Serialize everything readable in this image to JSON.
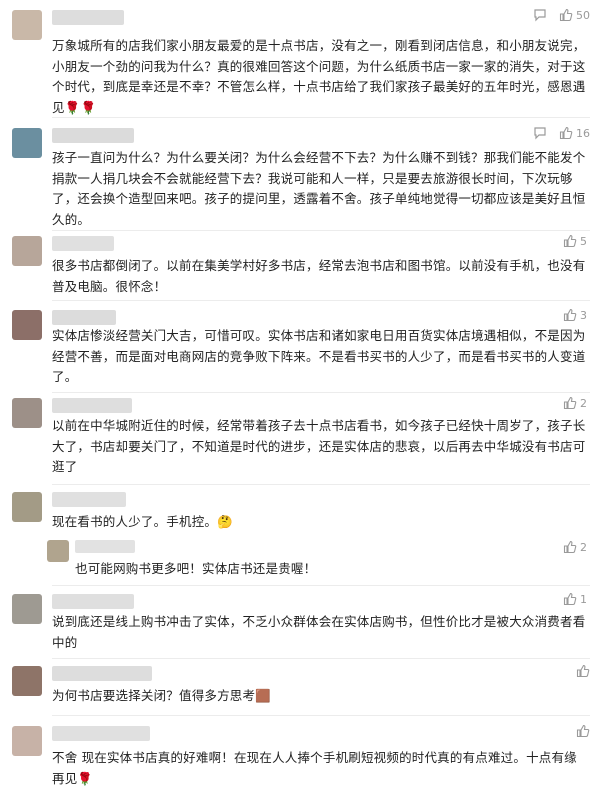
{
  "comments": [
    {
      "text": "万象城所有的店我们家小朋友最爱的是十点书店，没有之一，刚看到闭店信息，和小朋友说完，小朋友一个劲的问我为什么？真的很难回答这个问题，为什么纸质书店一家一家的消失，对于这个时代，到底是幸还是不幸？不管怎么样，十点书店给了我们家孩子最美好的五年时光，感恩遇见🌹🌹",
      "likes": "50",
      "avatar_color": "#c9b8a8",
      "name_color": "#d2d2d2"
    },
    {
      "text": "孩子一直问为什么？为什么要关闭？为什么会经营不下去？为什么赚不到钱？那我们能不能发个捐款一人捐几块会不会就能经营下去？我说可能和人一样，只是要去旅游很长时间，下次玩够了，还会换个造型回来吧。孩子的提问里，透露着不舍。孩子单纯地觉得一切都应该是美好且恒久的。",
      "likes": "16",
      "avatar_color": "#6b8fa0",
      "name_color": "#cfcfcf"
    },
    {
      "text": "很多书店都倒闭了。以前在集美学村好多书店，经常去泡书店和图书馆。以前没有手机，也没有普及电脑。很怀念！",
      "likes": "5",
      "avatar_color": "#b7a69a",
      "name_color": "#d5d5d5"
    },
    {
      "text": "实体店惨淡经营关门大吉，可惜可叹。实体书店和诸如家电日用百货实体店境遇相似，不是因为经营不善，而是面对电商网店的竞争败下阵来。不是看书买书的人少了，而是看书买书的人变道了。",
      "likes": "3",
      "avatar_color": "#8c6f68",
      "name_color": "#d0d0d0"
    },
    {
      "text": "以前在中华城附近住的时候，经常带着孩子去十点书店看书，如今孩子已经快十周岁了，孩子长大了，书店却要关门了，不知道是时代的进步，还是实体店的悲哀，以后再去中华城没有书店可逛了",
      "likes": "2",
      "avatar_color": "#9d9088",
      "name_color": "#d3d3d3"
    },
    {
      "text": "现在看书的人少了。手机控。🤔",
      "likes": "",
      "avatar_color": "#a39b86",
      "name_color": "#d6d6d6"
    },
    {
      "text": "也可能网购书更多吧！实体店书还是贵喔！",
      "likes": "2",
      "avatar_color": "#b0a48e",
      "name_color": "#d8d8d8"
    },
    {
      "text": "说到底还是线上购书冲击了实体，不乏小众群体会在实体店购书，但性价比才是被大众消费者看中的",
      "likes": "1",
      "avatar_color": "#9e9a92",
      "name_color": "#d4d4d4"
    },
    {
      "text": "为何书店要选择关闭？值得多方思考🟫",
      "likes": "",
      "avatar_color": "#8e7468",
      "name_color": "#d2d2d2"
    },
    {
      "text": "不舍 现在实体书店真的好难啊！在现在人人捧个手机刷短视频的时代真的有点难过。十点有缘再见🌹",
      "likes": "",
      "avatar_color": "#c7b2a7",
      "name_color": "#d5d5d5"
    }
  ]
}
